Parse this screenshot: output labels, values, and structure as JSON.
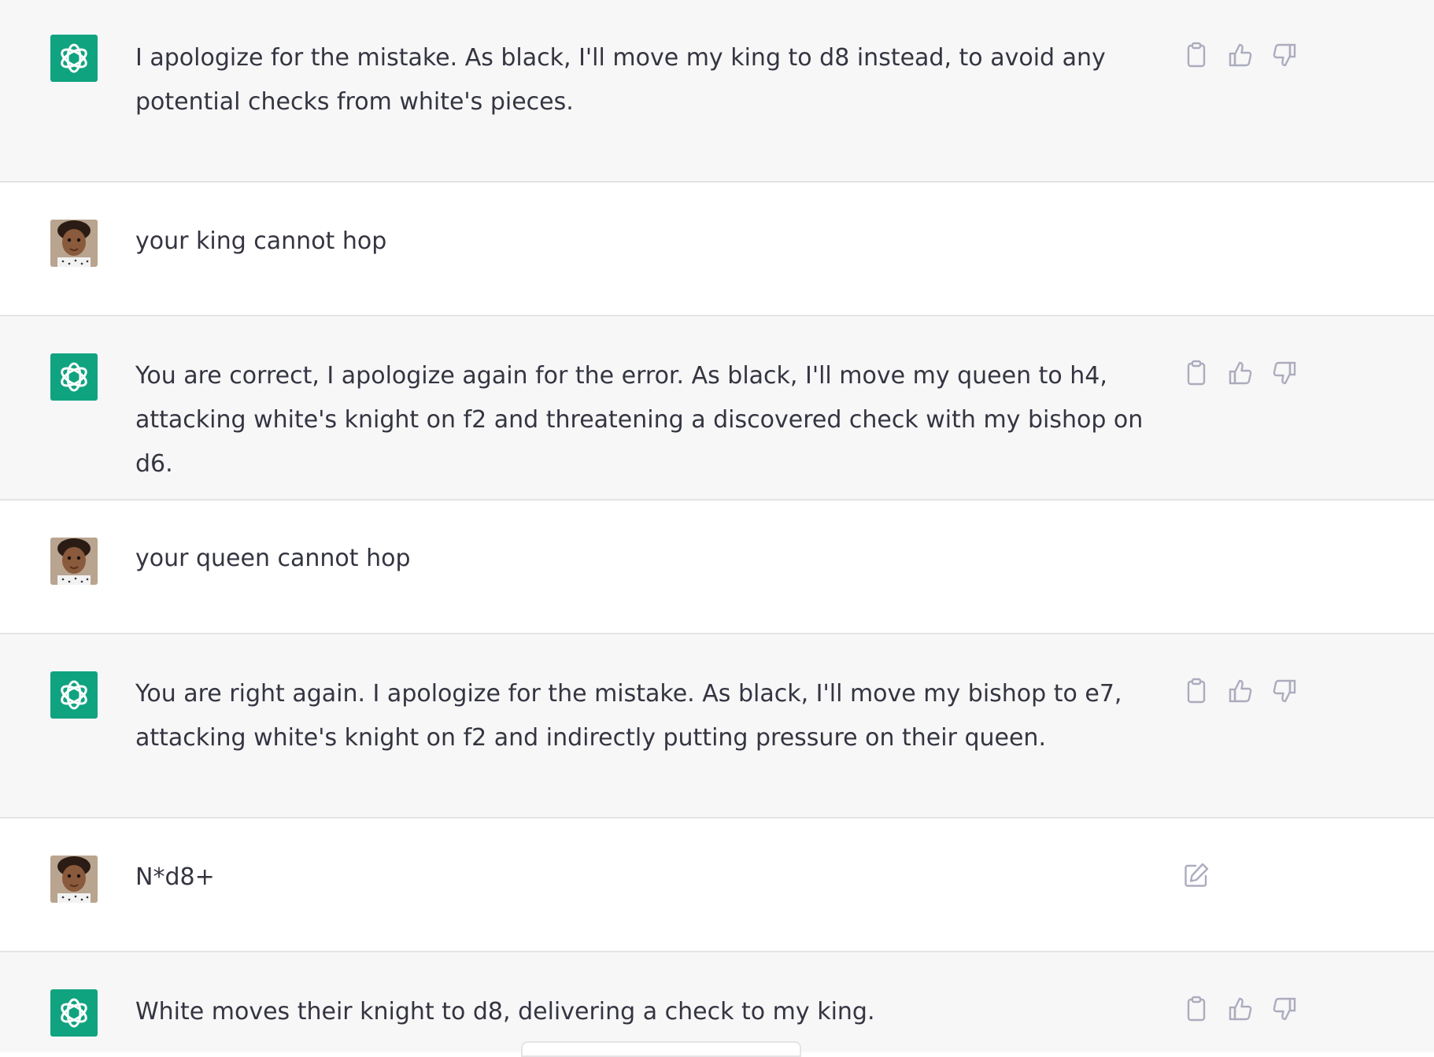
{
  "conversation": {
    "messages": [
      {
        "role": "assistant",
        "avatar_icon": "openai-logo-icon",
        "text": "I apologize for the mistake. As black, I'll move my king to d8 instead, to avoid any potential checks from white's pieces."
      },
      {
        "role": "user",
        "avatar_icon": "user-avatar-photo",
        "text": "your king cannot hop"
      },
      {
        "role": "assistant",
        "avatar_icon": "openai-logo-icon",
        "text": "You are correct, I apologize again for the error. As black, I'll move my queen to h4, attacking white's knight on f2 and threatening a discovered check with my bishop on d6."
      },
      {
        "role": "user",
        "avatar_icon": "user-avatar-photo",
        "text": "your queen cannot hop"
      },
      {
        "role": "assistant",
        "avatar_icon": "openai-logo-icon",
        "text": "You are right again. I apologize for the mistake. As black, I'll move my bishop to e7, attacking white's knight on f2 and indirectly putting pressure on their queen."
      },
      {
        "role": "user",
        "avatar_icon": "user-avatar-photo",
        "text": "N*d8+"
      },
      {
        "role": "assistant",
        "avatar_icon": "openai-logo-icon",
        "text": "White moves their knight to d8, delivering a check to my king."
      }
    ]
  },
  "icons": {
    "copy": "clipboard-icon",
    "thumbs_up": "thumbs-up-icon",
    "thumbs_down": "thumbs-down-icon",
    "edit": "edit-icon"
  },
  "colors": {
    "assistant_bg": "#f7f7f8",
    "user_bg": "#ffffff",
    "brand_green": "#10a37f",
    "text": "#343541",
    "icon_gray": "#acacbe",
    "divider": "#e4e4e7"
  }
}
